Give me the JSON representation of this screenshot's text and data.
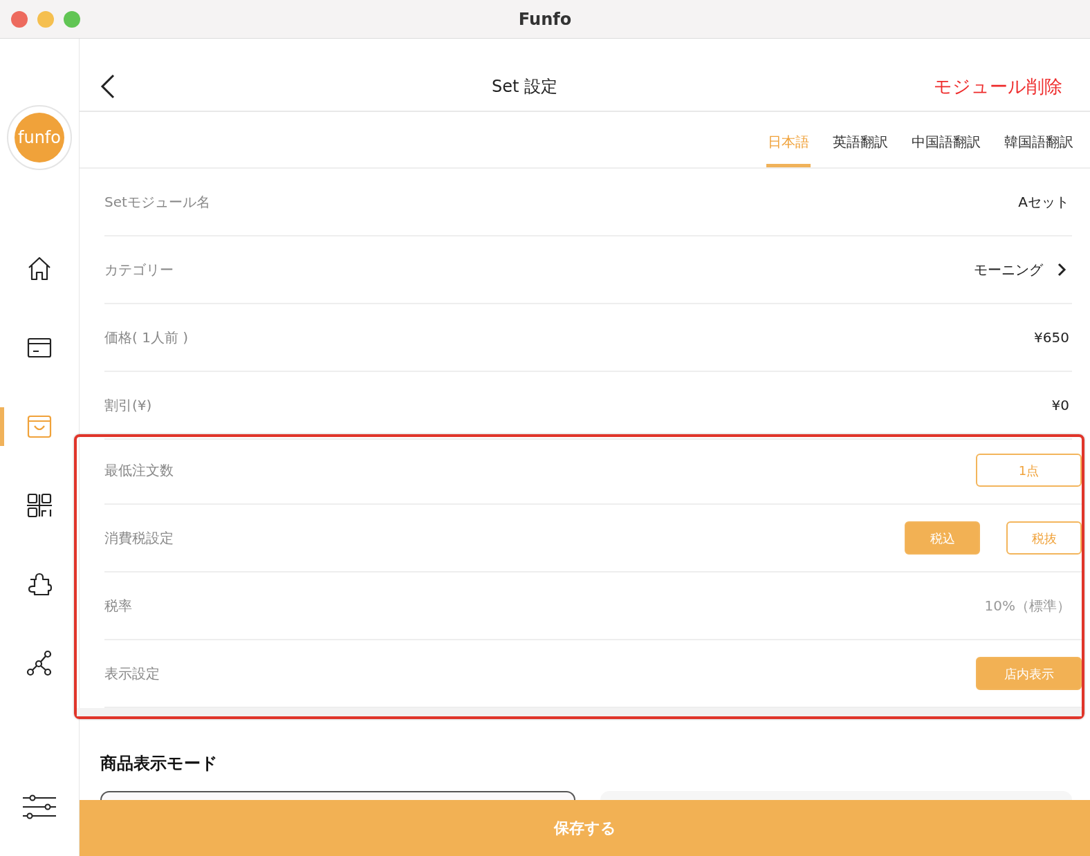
{
  "window": {
    "title": "Funfo"
  },
  "logo": {
    "text": "funfo"
  },
  "sidebar": {
    "items": [
      {
        "selected": false
      },
      {
        "selected": false
      },
      {
        "selected": true
      },
      {
        "selected": false
      },
      {
        "selected": false
      },
      {
        "selected": false
      }
    ]
  },
  "header": {
    "title": "Set 設定",
    "action": "モジュール削除"
  },
  "tabs": [
    {
      "label": "日本語",
      "selected": true
    },
    {
      "label": "英語翻訳",
      "selected": false
    },
    {
      "label": "中国語翻訳",
      "selected": false
    },
    {
      "label": "韓国語翻訳",
      "selected": false
    }
  ],
  "rows": [
    {
      "kind": "text",
      "label": "Setモジュール名",
      "value": "Aセット"
    },
    {
      "kind": "link",
      "label": "カテゴリー",
      "value": "モーニング"
    },
    {
      "kind": "text",
      "label": "価格( 1人前 )",
      "value": "¥650"
    },
    {
      "kind": "text",
      "label": "割引(¥)",
      "value": "¥0"
    }
  ],
  "highlighted_rows": {
    "highlighted": true,
    "rows": [
      {
        "kind": "buttons",
        "label": "最低注文数",
        "options": [
          {
            "label": "1点",
            "selected": false
          }
        ]
      },
      {
        "kind": "buttons",
        "label": "消費税設定",
        "options": [
          {
            "label": "税込",
            "selected": true
          },
          {
            "label": "税抜",
            "selected": false
          }
        ]
      },
      {
        "kind": "muted",
        "label": "税率",
        "value": "10%（標準）"
      },
      {
        "kind": "buttons",
        "label": "表示設定",
        "options": [
          {
            "label": "店内表示",
            "selected": true
          }
        ]
      }
    ]
  },
  "section": {
    "title": "商品表示モード"
  },
  "save_button": "保存する"
}
